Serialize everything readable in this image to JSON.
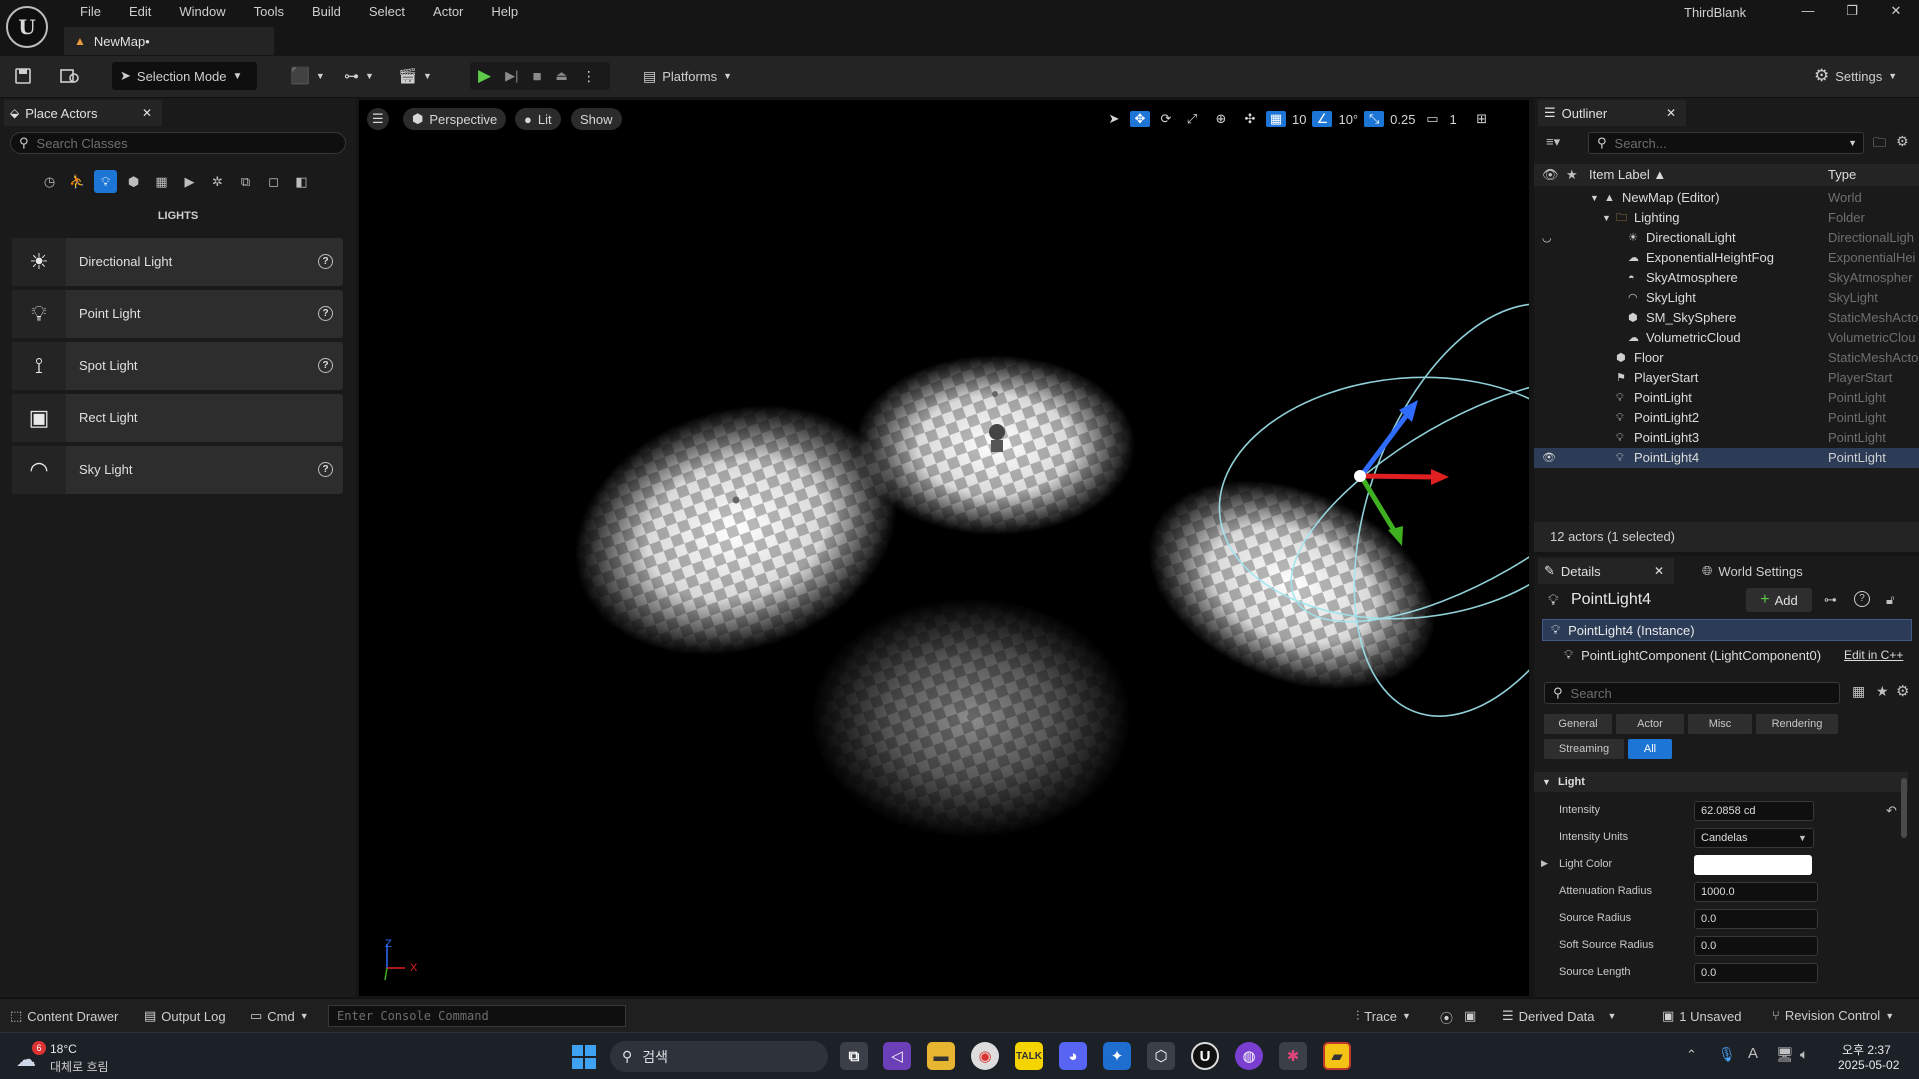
{
  "app": {
    "project_name": "ThirdBlank",
    "document_tab": "NewMap•"
  },
  "menu": [
    "File",
    "Edit",
    "Window",
    "Tools",
    "Build",
    "Select",
    "Actor",
    "Help"
  ],
  "window_controls": [
    "—",
    "❐",
    "✕"
  ],
  "toolbar": {
    "selection_mode": "Selection Mode",
    "platforms": "Platforms",
    "settings": "Settings"
  },
  "place_actors": {
    "tab_label": "Place Actors",
    "search_placeholder": "Search Classes",
    "category_title": "LIGHTS",
    "items": [
      {
        "label": "Directional Light",
        "icon": "sun-icon",
        "help": true
      },
      {
        "label": "Point Light",
        "icon": "bulb-icon",
        "help": true
      },
      {
        "label": "Spot Light",
        "icon": "spotlight-icon",
        "help": true
      },
      {
        "label": "Rect Light",
        "icon": "rect-light-icon",
        "help": false
      },
      {
        "label": "Sky Light",
        "icon": "skylight-icon",
        "help": true
      }
    ]
  },
  "viewport": {
    "perspective": "Perspective",
    "lit": "Lit",
    "show": "Show",
    "grid_snap": "10",
    "rotation_snap": "10°",
    "scale_snap": "0.25",
    "camera_speed": "1",
    "axis_labels": {
      "x": "X",
      "z": "Z"
    }
  },
  "outliner": {
    "tab_label": "Outliner",
    "search_placeholder": "Search...",
    "col_label": "Item Label ▲",
    "col_type": "Type",
    "rows": [
      {
        "label": "NewMap (Editor)",
        "type": "World",
        "depth": 0,
        "icon": "map-icon"
      },
      {
        "label": "Lighting",
        "type": "Folder",
        "depth": 1,
        "icon": "folder-icon"
      },
      {
        "label": "DirectionalLight",
        "type": "DirectionalLigh",
        "depth": 2,
        "icon": "sun-icon"
      },
      {
        "label": "ExponentialHeightFog",
        "type": "ExponentialHei",
        "depth": 2,
        "icon": "fog-icon"
      },
      {
        "label": "SkyAtmosphere",
        "type": "SkyAtmospher",
        "depth": 2,
        "icon": "atmosphere-icon"
      },
      {
        "label": "SkyLight",
        "type": "SkyLight",
        "depth": 2,
        "icon": "skylight-icon"
      },
      {
        "label": "SM_SkySphere",
        "type": "StaticMeshActo",
        "depth": 2,
        "icon": "cube-icon"
      },
      {
        "label": "VolumetricCloud",
        "type": "VolumetricClou",
        "depth": 2,
        "icon": "cloud-icon"
      },
      {
        "label": "Floor",
        "type": "StaticMeshActo",
        "depth": 1,
        "icon": "cube-icon"
      },
      {
        "label": "PlayerStart",
        "type": "PlayerStart",
        "depth": 1,
        "icon": "flag-icon"
      },
      {
        "label": "PointLight",
        "type": "PointLight",
        "depth": 1,
        "icon": "bulb-icon"
      },
      {
        "label": "PointLight2",
        "type": "PointLight",
        "depth": 1,
        "icon": "bulb-icon"
      },
      {
        "label": "PointLight3",
        "type": "PointLight",
        "depth": 1,
        "icon": "bulb-icon"
      },
      {
        "label": "PointLight4",
        "type": "PointLight",
        "depth": 1,
        "icon": "bulb-icon",
        "selected": true
      }
    ],
    "footer": "12 actors (1 selected)"
  },
  "details": {
    "tab_label": "Details",
    "world_settings_tab": "World Settings",
    "actor_name": "PointLight4",
    "add_button": "Add",
    "instance": "PointLight4 (Instance)",
    "component": "PointLightComponent (LightComponent0)",
    "edit_cpp": "Edit in C++",
    "search_placeholder": "Search",
    "filters": [
      "General",
      "Actor",
      "Misc",
      "Rendering",
      "Streaming",
      "All"
    ],
    "section": "Light",
    "props": [
      {
        "label": "Intensity",
        "value": "62.0858 cd"
      },
      {
        "label": "Intensity Units",
        "value": "Candelas"
      },
      {
        "label": "Light Color",
        "value": ""
      },
      {
        "label": "Attenuation Radius",
        "value": "1000.0"
      },
      {
        "label": "Source Radius",
        "value": "0.0"
      },
      {
        "label": "Soft Source Radius",
        "value": "0.0"
      },
      {
        "label": "Source Length",
        "value": "0.0"
      }
    ],
    "light_color_hex": "#ffffff"
  },
  "statusbar": {
    "content_drawer": "Content Drawer",
    "output_log": "Output Log",
    "cmd": "Cmd",
    "console_placeholder": "Enter Console Command",
    "trace": "Trace",
    "derived_data": "Derived Data",
    "unsaved": "1 Unsaved",
    "revision_control": "Revision Control"
  },
  "taskbar": {
    "weather_temp": "18°C",
    "weather_desc": "대체로 흐림",
    "weather_badge": "6",
    "search_label": "검색",
    "time": "오후 2:37",
    "date": "2025-05-02"
  },
  "colors": {
    "accent": "#1d76d6",
    "selection": "#2c3c57",
    "bg_panel": "#1a1a1a"
  }
}
